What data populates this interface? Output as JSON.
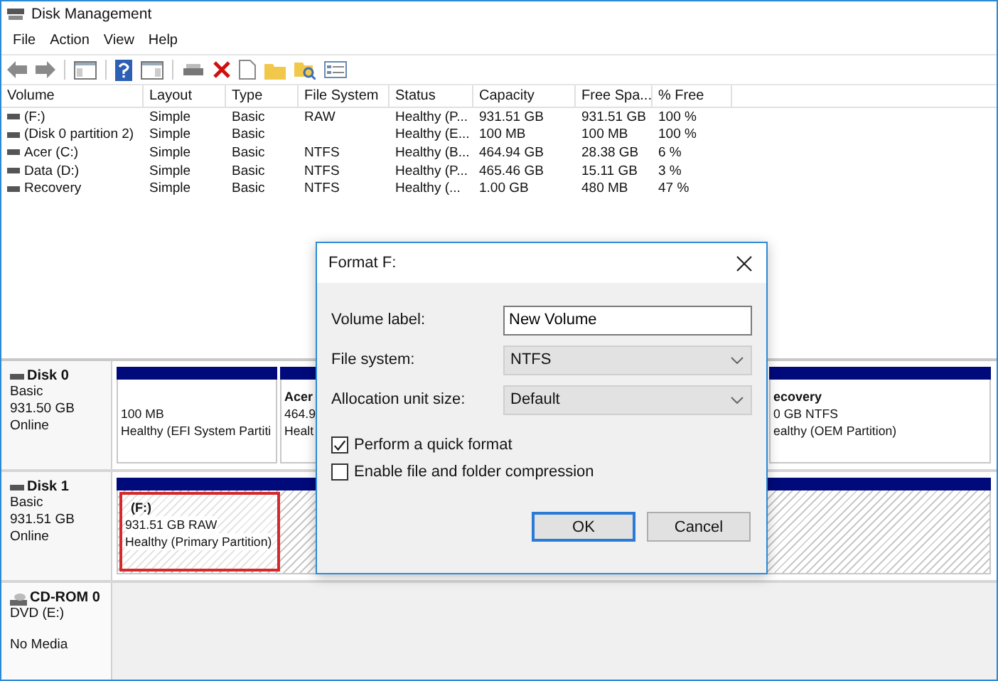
{
  "window": {
    "title": "Disk Management"
  },
  "menu": [
    "File",
    "Action",
    "View",
    "Help"
  ],
  "volume_list": {
    "columns": [
      "Volume",
      "Layout",
      "Type",
      "File System",
      "Status",
      "Capacity",
      "Free Spa...",
      "% Free"
    ],
    "rows": [
      {
        "cells": [
          "(F:)",
          "Simple",
          "Basic",
          "RAW",
          "Healthy (P...",
          "931.51 GB",
          "931.51 GB",
          "100 %"
        ]
      },
      {
        "cells": [
          "(Disk 0 partition 2)",
          "Simple",
          "Basic",
          "",
          "Healthy (E...",
          "100 MB",
          "100 MB",
          "100 %"
        ]
      },
      {
        "cells": [
          "Acer (C:)",
          "Simple",
          "Basic",
          "NTFS",
          "Healthy (B...",
          "464.94 GB",
          "28.38 GB",
          "6 %"
        ]
      },
      {
        "cells": [
          "Data (D:)",
          "Simple",
          "Basic",
          "NTFS",
          "Healthy (P...",
          "465.46 GB",
          "15.11 GB",
          "3 %"
        ]
      },
      {
        "cells": [
          "Recovery",
          "Simple",
          "Basic",
          "NTFS",
          "Healthy (...",
          "1.00 GB",
          "480 MB",
          "47 %"
        ]
      }
    ]
  },
  "disks": [
    {
      "kind": "disk",
      "name": "Disk 0",
      "lines": [
        "Basic",
        "931.50 GB",
        "Online"
      ],
      "partitions": [
        {
          "hatched": false,
          "selected": false,
          "lines": [
            "100 MB",
            "Healthy (EFI System Partiti"
          ]
        },
        {
          "hatched": false,
          "selected": false,
          "name": "Acer",
          "lines": [
            "464.9",
            "Healt"
          ]
        },
        {
          "hatched": false,
          "selected": false,
          "name": "ecovery",
          "lines": [
            "0 GB NTFS",
            "ealthy (OEM Partition)"
          ]
        }
      ]
    },
    {
      "kind": "disk",
      "name": "Disk 1",
      "lines": [
        "Basic",
        "931.51 GB",
        "Online"
      ],
      "partitions": [
        {
          "hatched": true,
          "selected": true,
          "name": "(F:)",
          "lines": [
            "931.51 GB RAW",
            "Healthy (Primary Partition)"
          ]
        }
      ]
    },
    {
      "kind": "cdrom",
      "name": "CD-ROM 0",
      "lines": [
        "DVD (E:)",
        "No Media"
      ]
    }
  ],
  "dialog": {
    "title": "Format F:",
    "fields": [
      {
        "kind": "text",
        "label": "Volume label:",
        "value": "New Volume"
      },
      {
        "kind": "select",
        "label": "File system:",
        "value": "NTFS"
      },
      {
        "kind": "select",
        "label": "Allocation unit size:",
        "value": "Default"
      }
    ],
    "checkboxes": [
      {
        "label": "Perform a quick format",
        "checked": true
      },
      {
        "label": "Enable file and folder compression",
        "checked": false
      }
    ],
    "buttons": [
      {
        "label": "OK",
        "default": true
      },
      {
        "label": "Cancel",
        "default": false
      }
    ]
  }
}
